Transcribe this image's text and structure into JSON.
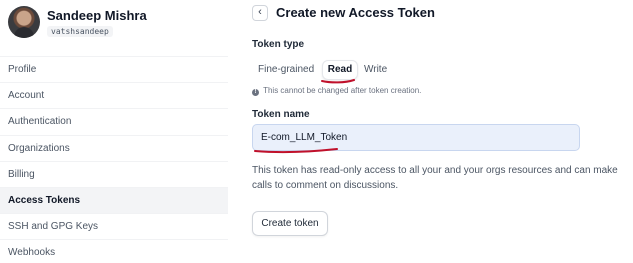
{
  "user": {
    "name": "Sandeep Mishra",
    "handle": "vatshsandeep"
  },
  "nav": {
    "items": [
      {
        "label": "Profile",
        "active": false
      },
      {
        "label": "Account",
        "active": false
      },
      {
        "label": "Authentication",
        "active": false
      },
      {
        "label": "Organizations",
        "active": false
      },
      {
        "label": "Billing",
        "active": false
      },
      {
        "label": "Access Tokens",
        "active": true
      },
      {
        "label": "SSH and GPG Keys",
        "active": false
      },
      {
        "label": "Webhooks",
        "active": false
      }
    ]
  },
  "header": {
    "back_icon": "chevron-left-icon",
    "back_glyph": "‹",
    "title": "Create new Access Token"
  },
  "token_type": {
    "label": "Token type",
    "options": [
      "Fine-grained",
      "Read",
      "Write"
    ],
    "selected": "Read",
    "note": "This cannot be changed after token creation.",
    "note_icon": "info-icon",
    "note_icon_glyph": "!"
  },
  "token_name": {
    "label": "Token name",
    "value": "E-com_LLM_Token"
  },
  "description": "This token has read-only access to all your and your orgs resources and can make calls to comment on discussions.",
  "actions": {
    "create_label": "Create token"
  },
  "colors": {
    "annotation_underline": "#c0112b",
    "input_background": "#eaf0fb"
  }
}
